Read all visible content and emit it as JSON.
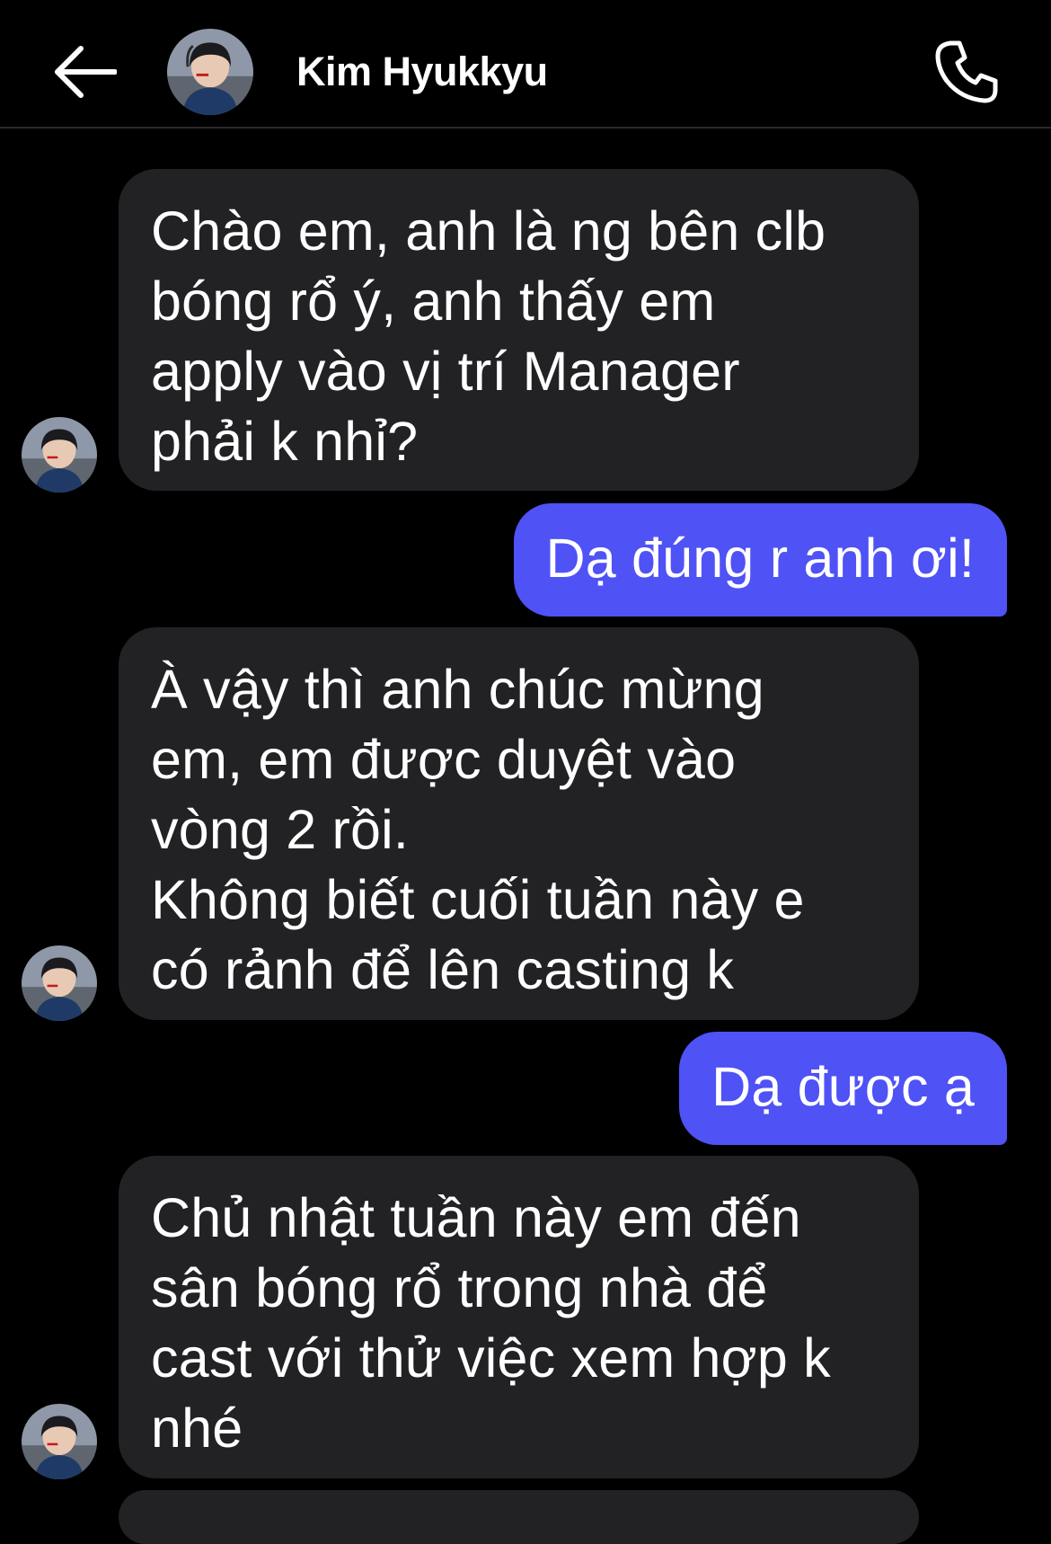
{
  "header": {
    "contact_name": "Kim Hyukkyu",
    "back_icon": "arrow-left-icon",
    "call_icon": "phone-icon"
  },
  "colors": {
    "background": "#000000",
    "incoming_bubble": "#222224",
    "outgoing_bubble": "#4f52f5",
    "text": "#ffffff"
  },
  "messages": [
    {
      "direction": "incoming",
      "text": "Chào em, anh là ng bên clb\nbóng rổ ý, anh thấy em\napply vào vị trí Manager\nphải k nhỉ?"
    },
    {
      "direction": "outgoing",
      "text": "Dạ đúng r anh ơi!"
    },
    {
      "direction": "incoming",
      "text": "À vậy thì anh chúc mừng\nem, em được duyệt vào\nvòng 2 rồi.\nKhông biết cuối tuần này e\ncó rảnh để lên casting k"
    },
    {
      "direction": "outgoing",
      "text": "Dạ được ạ"
    },
    {
      "direction": "incoming",
      "text": "Chủ nhật tuần này em đến\nsân bóng rổ trong nhà để\ncast với thử việc xem hợp k\nnhé"
    }
  ]
}
